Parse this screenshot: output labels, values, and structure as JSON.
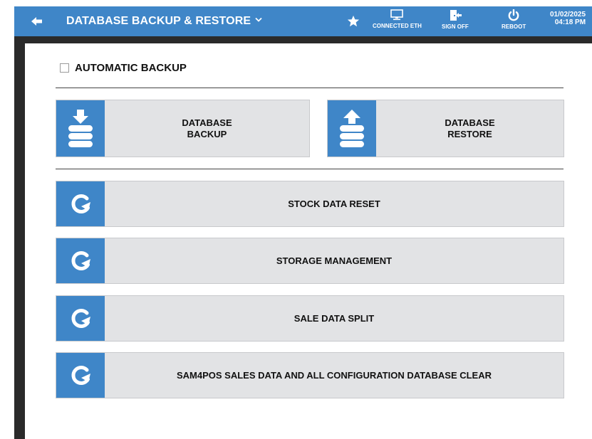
{
  "header": {
    "title": "DATABASE BACKUP & RESTORE",
    "connection_label": "CONNECTED ETH",
    "sign_off_label": "SIGN OFF",
    "reboot_label": "REBOOT",
    "date": "01/02/2025",
    "time": "04:18 PM",
    "icons": {
      "back": "back-arrow-icon",
      "dropdown": "chevron-down-icon",
      "favorite": "star-icon",
      "connection": "monitor-icon",
      "sign_off": "exit-door-icon",
      "reboot": "power-icon"
    }
  },
  "options": {
    "automatic_backup_label": "AUTOMATIC BACKUP",
    "automatic_backup_checked": false
  },
  "buttons": {
    "database_backup": "DATABASE\nBACKUP",
    "database_restore": "DATABASE\nRESTORE",
    "stock_data_reset": "STOCK DATA RESET",
    "storage_management": "STORAGE MANAGEMENT",
    "sale_data_split": "SALE DATA SPLIT",
    "database_clear": "SAM4POS SALES DATA AND ALL CONFIGURATION DATABASE CLEAR"
  },
  "colors": {
    "accent": "#3f86c8",
    "button_bg": "#e2e3e5",
    "frame": "#2a2a2a"
  }
}
